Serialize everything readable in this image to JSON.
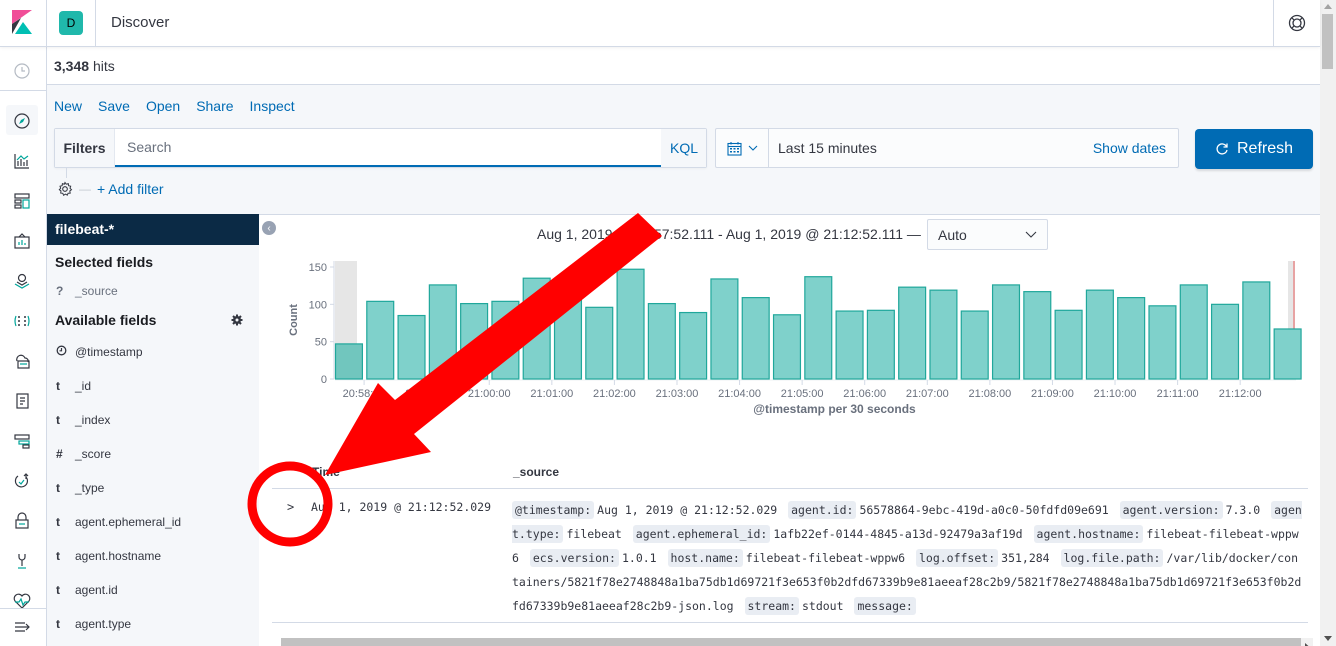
{
  "header": {
    "space_initial": "D",
    "app_title": "Discover"
  },
  "hits": {
    "count": "3,348",
    "label": "hits"
  },
  "top_nav": [
    {
      "label": "New"
    },
    {
      "label": "Save"
    },
    {
      "label": "Open"
    },
    {
      "label": "Share"
    },
    {
      "label": "Inspect"
    }
  ],
  "query": {
    "filters_label": "Filters",
    "search_placeholder": "Search",
    "search_value": "",
    "language": "KQL"
  },
  "date_picker": {
    "range": "Last 15 minutes",
    "show_dates": "Show dates"
  },
  "refresh_label": "Refresh",
  "add_filter_label": "+ Add filter",
  "sidebar": {
    "index_pattern": "filebeat-*",
    "selected_title": "Selected fields",
    "selected_fields": [
      {
        "type": "?",
        "name": "_source"
      }
    ],
    "available_title": "Available fields",
    "available_fields": [
      {
        "type": "clock",
        "name": "@timestamp"
      },
      {
        "type": "t",
        "name": "_id"
      },
      {
        "type": "t",
        "name": "_index"
      },
      {
        "type": "#",
        "name": "_score"
      },
      {
        "type": "t",
        "name": "_type"
      },
      {
        "type": "t",
        "name": "agent.ephemeral_id"
      },
      {
        "type": "t",
        "name": "agent.hostname"
      },
      {
        "type": "t",
        "name": "agent.id"
      },
      {
        "type": "t",
        "name": "agent.type"
      }
    ]
  },
  "histogram": {
    "time_range": "Aug 1, 2019 @ 20:57:52.111 - Aug 1, 2019 @ 21:12:52.111 —",
    "interval": "Auto"
  },
  "chart_data": {
    "type": "bar",
    "title": "",
    "xlabel": "@timestamp per 30 seconds",
    "ylabel": "Count",
    "ylim": [
      0,
      160
    ],
    "yticks": [
      0,
      50,
      100,
      150
    ],
    "xtick_labels": [
      "20:58:00",
      "20:59:00",
      "21:00:00",
      "21:01:00",
      "21:02:00",
      "21:03:00",
      "21:04:00",
      "21:05:00",
      "21:06:00",
      "21:07:00",
      "21:08:00",
      "21:09:00",
      "21:10:00",
      "21:11:00",
      "21:12:00"
    ],
    "categories": [
      "20:57:30",
      "20:58:00",
      "20:58:30",
      "20:59:00",
      "20:59:30",
      "21:00:00",
      "21:00:30",
      "21:01:00",
      "21:01:30",
      "21:02:00",
      "21:02:30",
      "21:03:00",
      "21:03:30",
      "21:04:00",
      "21:04:30",
      "21:05:00",
      "21:05:30",
      "21:06:00",
      "21:06:30",
      "21:07:00",
      "21:07:30",
      "21:08:00",
      "21:08:30",
      "21:09:00",
      "21:09:30",
      "21:10:00",
      "21:10:30",
      "21:11:00",
      "21:11:30",
      "21:12:00",
      "21:12:30"
    ],
    "values": [
      47,
      104,
      85,
      126,
      101,
      104,
      135,
      111,
      96,
      147,
      101,
      89,
      134,
      109,
      86,
      137,
      91,
      92,
      123,
      119,
      91,
      126,
      117,
      92,
      119,
      109,
      98,
      126,
      100,
      130,
      67
    ],
    "partial_buckets": [
      0,
      30
    ],
    "bar_color": "#54b399",
    "grid": false,
    "legend": "none"
  },
  "table": {
    "columns": [
      "Time",
      "_source"
    ],
    "rows": [
      {
        "time": "Aug 1, 2019 @ 21:12:52.029",
        "source": [
          {
            "key": "@timestamp:",
            "value": "Aug 1, 2019 @ 21:12:52.029"
          },
          {
            "key": "agent.id:",
            "value": "56578864-9ebc-419d-a0c0-50fdfd09e691"
          },
          {
            "key": "agent.version:",
            "value": "7.3.0"
          },
          {
            "key": "agent.type:",
            "value": "filebeat"
          },
          {
            "key": "agent.ephemeral_id:",
            "value": "1afb22ef-0144-4845-a13d-92479a3af19d"
          },
          {
            "key": "agent.hostname:",
            "value": "filebeat-filebeat-wppw6"
          },
          {
            "key": "ecs.version:",
            "value": "1.0.1"
          },
          {
            "key": "host.name:",
            "value": "filebeat-filebeat-wppw6"
          },
          {
            "key": "log.offset:",
            "value": "351,284"
          },
          {
            "key": "log.file.path:",
            "value": "/var/lib/docker/containers/5821f78e2748848a1ba75db1d69721f3e653f0b2dfd67339b9e81aeeaf28c2b9/5821f78e2748848a1ba75db1d69721f3e653f0b2dfd67339b9e81aeeaf28c2b9-json.log"
          },
          {
            "key": "stream:",
            "value": "stdout"
          },
          {
            "key": "message:",
            "value": ""
          }
        ]
      }
    ]
  },
  "colors": {
    "accent": "#006bb4",
    "index_pattern_bg": "#0b2a45",
    "bar_fill": "#7fd1cb",
    "bar_stroke": "#20a79b",
    "annotation": "#ff0000"
  }
}
